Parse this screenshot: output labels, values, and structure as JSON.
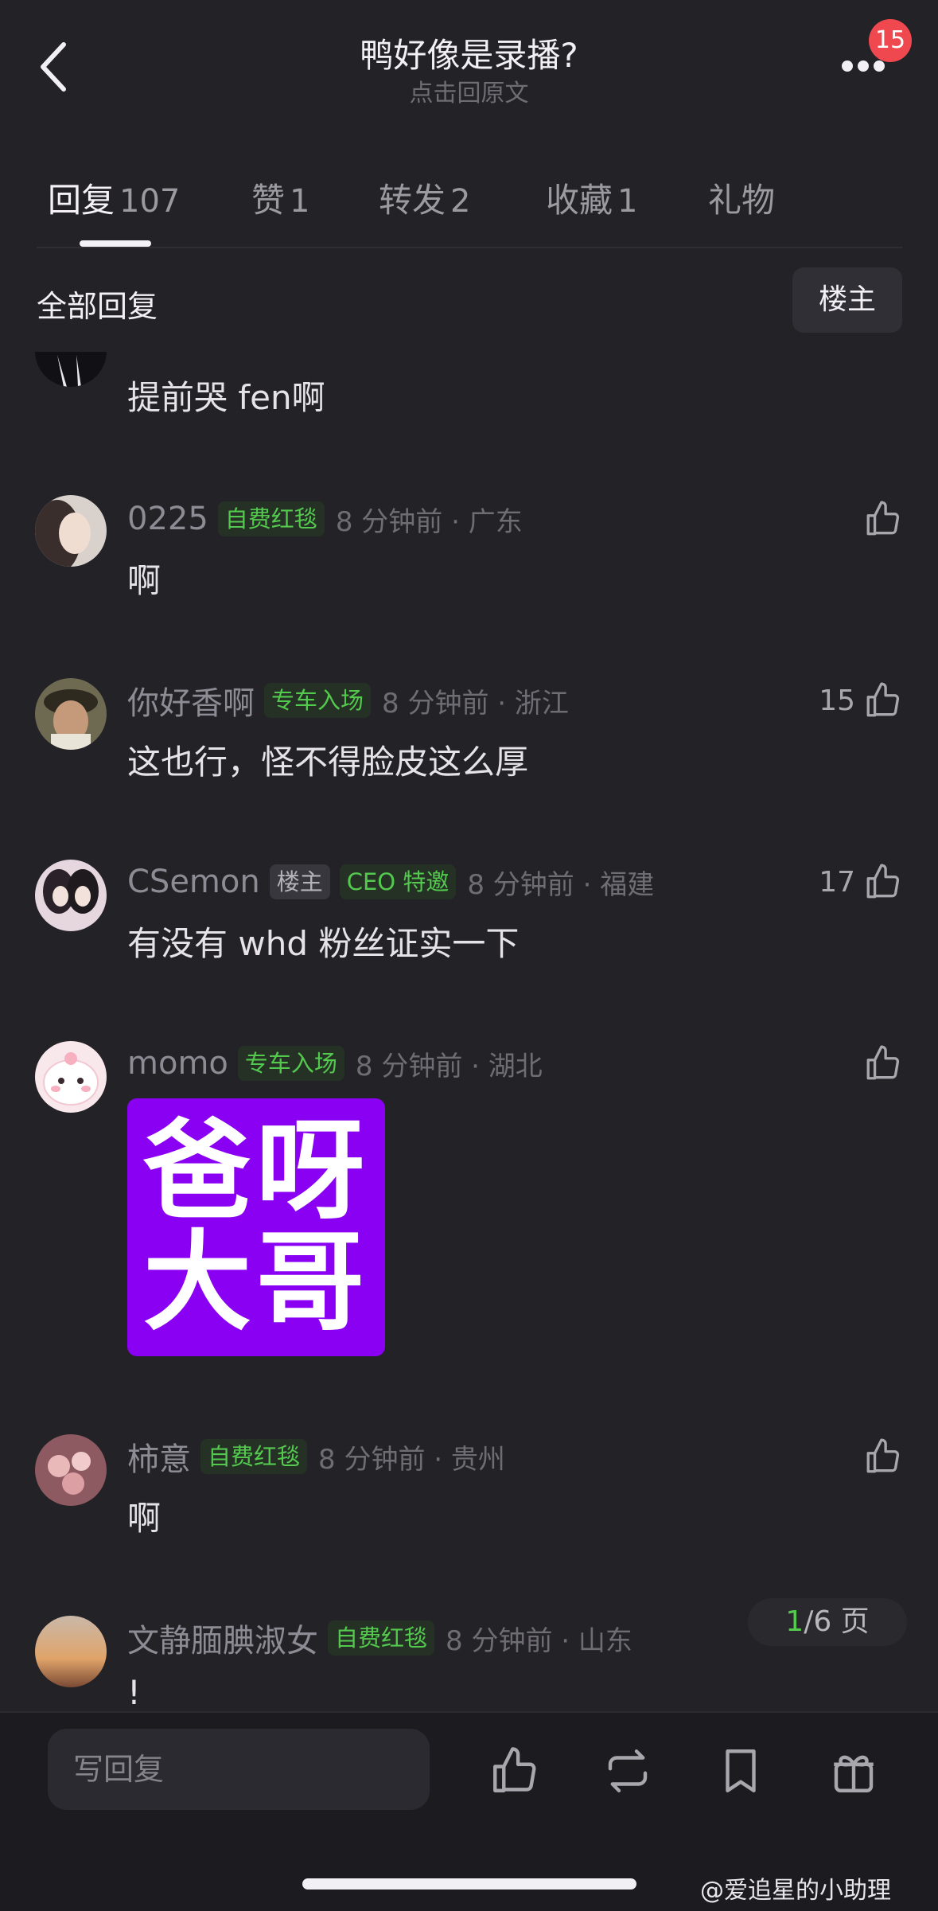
{
  "header": {
    "title": "鸭好像是录播?",
    "subtitle": "点击回原文",
    "notification_count": "15"
  },
  "tabs": [
    {
      "label": "回复",
      "count": "107",
      "active": true
    },
    {
      "label": "赞",
      "count": "1"
    },
    {
      "label": "转发",
      "count": "2"
    },
    {
      "label": "收藏",
      "count": "1"
    },
    {
      "label": "礼物",
      "count": ""
    }
  ],
  "section": {
    "title": "全部回复",
    "filter_label": "楼主"
  },
  "comments": [
    {
      "text": "提前哭 fen啊"
    },
    {
      "name": "0225",
      "badges": [
        "自费红毯"
      ],
      "time": "8 分钟前",
      "location": "广东",
      "likes": "",
      "text": "啊"
    },
    {
      "name": "你好香啊",
      "badges": [
        "专车入场"
      ],
      "time": "8 分钟前",
      "location": "浙江",
      "likes": "15",
      "text": "这也行，怪不得脸皮这么厚"
    },
    {
      "name": "CSemon",
      "badges": [
        "楼主",
        "CEO 特邀"
      ],
      "time": "8 分钟前",
      "location": "福建",
      "likes": "17",
      "text": "有没有 whd 粉丝证实一下"
    },
    {
      "name": "momo",
      "badges": [
        "专车入场"
      ],
      "time": "8 分钟前",
      "location": "湖北",
      "likes": "",
      "sticker": {
        "line1": "爸呀",
        "line2": "大哥"
      }
    },
    {
      "name": "柿意",
      "badges": [
        "自费红毯"
      ],
      "time": "8 分钟前",
      "location": "贵州",
      "likes": "",
      "text": "啊"
    },
    {
      "name": "文静腼腆淑女",
      "badges": [
        "自费红毯"
      ],
      "time": "8 分钟前",
      "location": "山东",
      "likes": "",
      "text": "!"
    }
  ],
  "pagination": {
    "current": "1",
    "total_label": "/6 页"
  },
  "bottom_bar": {
    "reply_placeholder": "写回复",
    "icons": [
      "thumbs-up-icon",
      "repost-icon",
      "bookmark-icon",
      "gift-icon"
    ]
  },
  "watermark": "@爱追星的小助理",
  "colors": {
    "background": "#232227",
    "badge_green": "#53c94e",
    "notification_red": "#f0484f",
    "sticker_purple": "#8a00f2"
  }
}
